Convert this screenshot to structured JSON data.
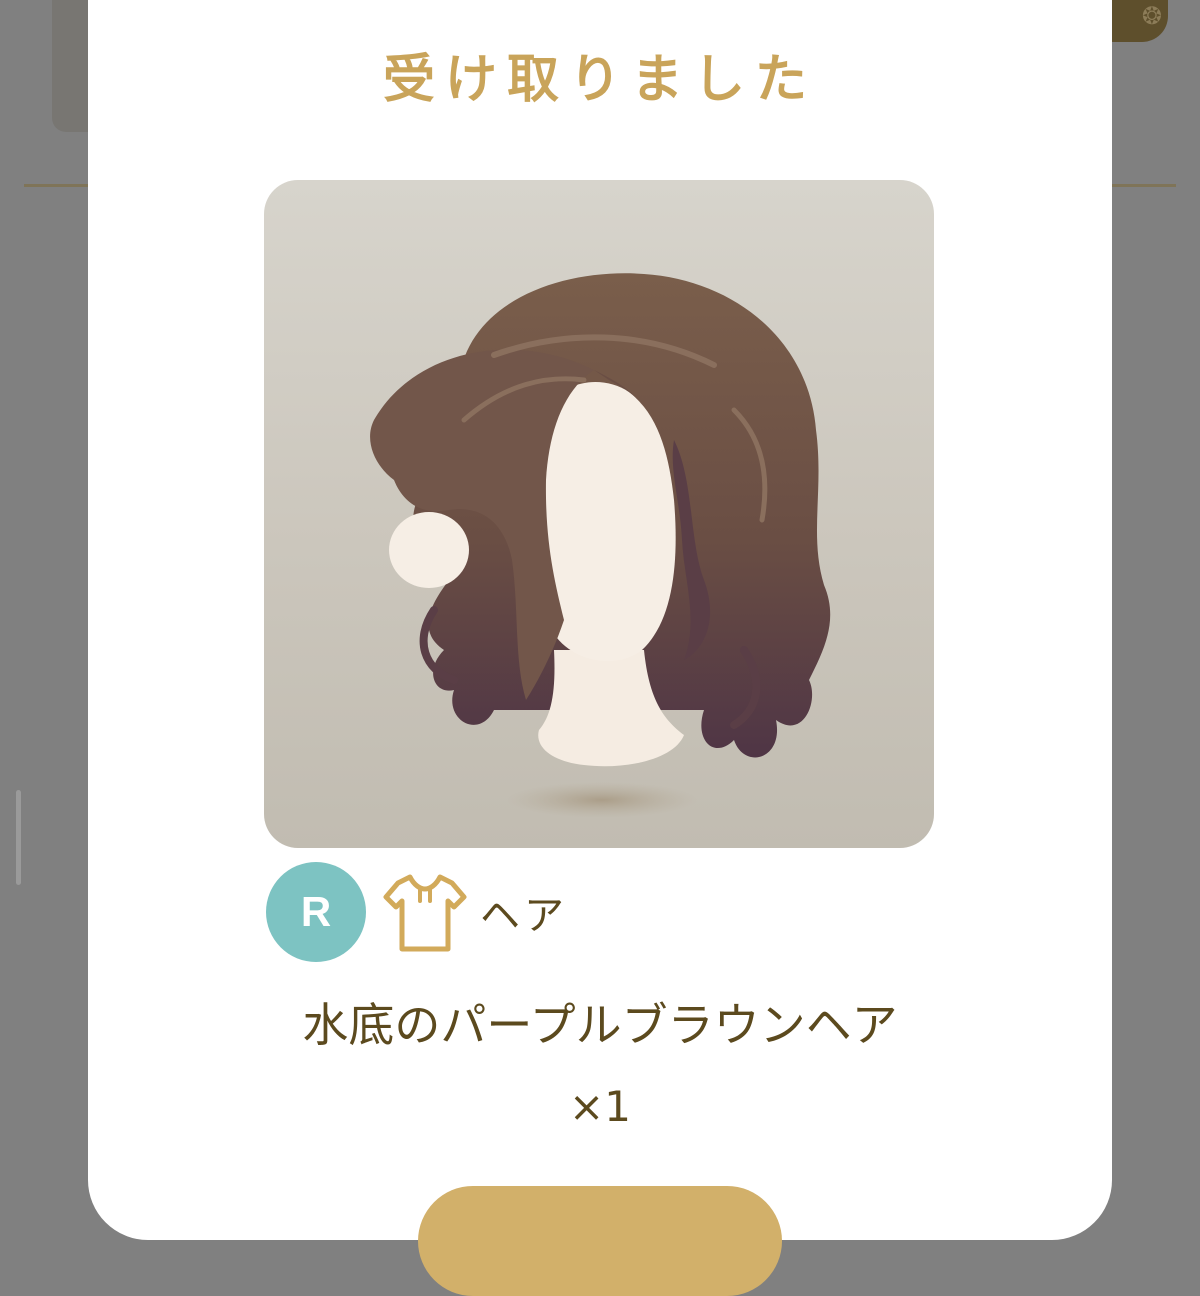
{
  "background": {
    "overlay_color": "#808080",
    "corner_button_icon": "badge-icon"
  },
  "modal": {
    "title": "受け取りました",
    "title_color": "#c9a45a",
    "item": {
      "image_description_icon": "wavy-hair-on-mannequin-icon",
      "rarity": "R",
      "rarity_color": "#7dc3c2",
      "category_icon": "shirt-icon",
      "category": "ヘア",
      "name": "水底のパープルブラウンヘア",
      "quantity": "×1"
    },
    "ok_button_color": "#d2b06a",
    "text_color": "#5c4a1e"
  }
}
